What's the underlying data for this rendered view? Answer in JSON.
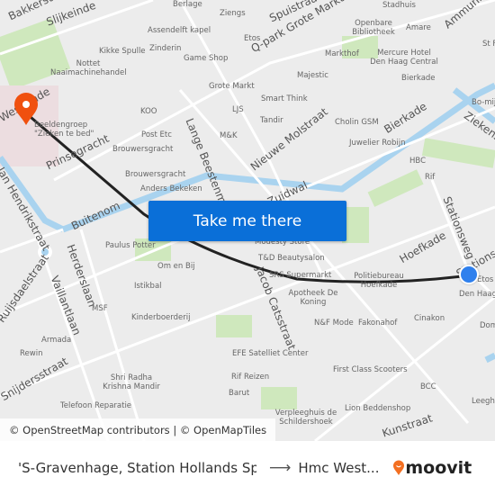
{
  "map": {
    "streets": [
      "Bakkerstraat",
      "Slijkeinde",
      "Spuistraat",
      "Q-park Grote Marktstraat",
      "Ammunitiehaven",
      "Prinsegracht",
      "Lange Beestenmarkt",
      "Nieuwe Molstraat",
      "Bierkade",
      "Zuidwal",
      "Ziekenstraat",
      "Stationsweg",
      "Buitenom",
      "Hoefkade",
      "Stationsplein",
      "Herderslaan",
      "Vaillantlaan",
      "Ruijsdaelstraat",
      "Snijdersstraat",
      "Jacob Catsstraat",
      "Kunstraat",
      "Westeinde",
      "Jan Hendrikstraat"
    ],
    "labels": [
      "Berlage",
      "Ziengs",
      "Assendelft kapel",
      "Etos",
      "Stadhuis",
      "Openbare Bibliotheek",
      "Amare",
      "Kikke Spulle",
      "Zinderin",
      "Game Shop",
      "Markthof",
      "Mercure Hotel Den Haag Central",
      "Nottet Naaimachinehandel",
      "Majestic",
      "Bierkade",
      "Grote Markt",
      "Smart Think",
      "KOO",
      "LJS",
      "Tandir",
      "Cholin GSM",
      "Beeldengroep \"Zieken te bed\"",
      "Post Etc",
      "M&K",
      "Juwelier Robijn",
      "Brouwersgracht",
      "HBC",
      "Brouwersgracht",
      "Rif",
      "Anders Bekeken",
      "Paulus Potter",
      "Modesty Store",
      "T&D Beautysalon",
      "Om en Bij",
      "SRS Supermarkt",
      "Politiebureau Hoefkade",
      "Istikbal",
      "Etos",
      "Den Haag",
      "Apotheek De Koning",
      "MSF",
      "Kinderboerderij",
      "N&F Mode",
      "Fakonahof",
      "Cinakon",
      "Armada",
      "Rewin",
      "EFE Satelliet Center",
      "First Class Scooters",
      "Shri Radha Krishna Mandir",
      "Rif Reizen",
      "BCC",
      "Barut",
      "Telefoon Reparatie",
      "Lion Beddenshop",
      "Verpleeghuis de Schildershoek",
      "Leeghwaterplein",
      "St F",
      "Bo-mij",
      "Dom"
    ],
    "origin_marker_color": "#f0500f",
    "destination_marker_color": "#2f80ed",
    "route_color": "#222222"
  },
  "cta": {
    "label": "Take me there"
  },
  "attribution": "© OpenStreetMap contributors | © OpenMapTiles",
  "bottom_bar": {
    "origin": "'S-Gravenhage, Station Hollands Spo...",
    "arrow_icon": "arrow-right-icon",
    "destination": "Hmc West...",
    "brand": "moovit",
    "brand_color": "#f36f21"
  }
}
